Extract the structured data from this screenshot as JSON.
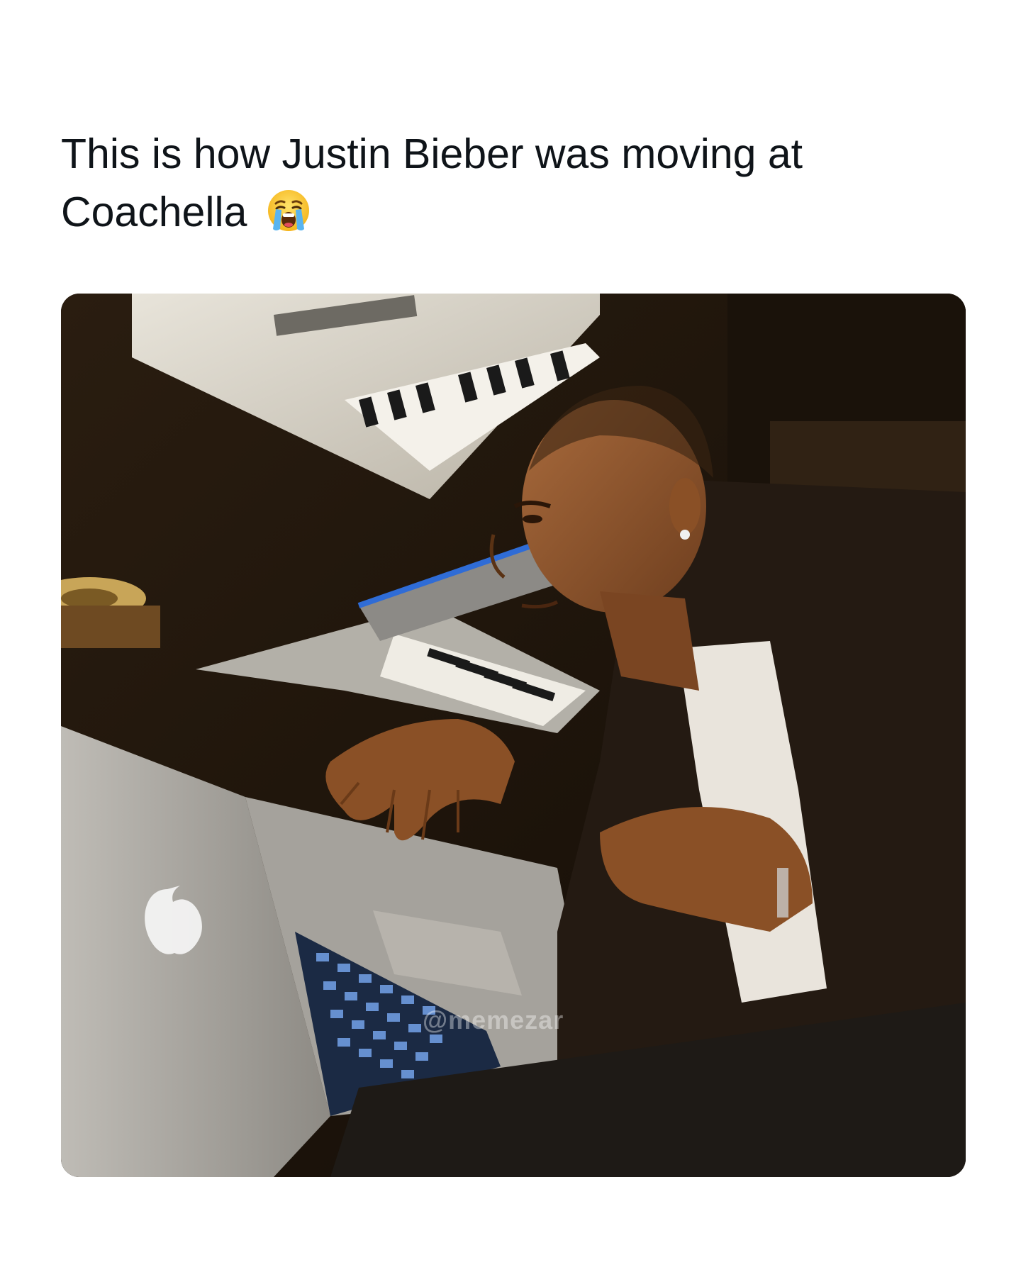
{
  "tweet": {
    "text": "This is how Justin Bieber was moving at Coachella",
    "emoji": "loudly-crying-face-emoji"
  },
  "media": {
    "watermark": "@memezar"
  },
  "colors": {
    "text": "#0f1419",
    "background": "#ffffff"
  }
}
